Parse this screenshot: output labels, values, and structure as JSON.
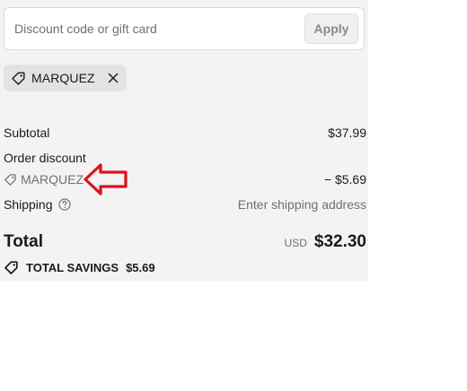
{
  "discount": {
    "placeholder": "Discount code or gift card",
    "apply_label": "Apply"
  },
  "applied_code": {
    "label": "MARQUEZ",
    "tag_icon": "tag-icon",
    "remove_icon": "close-icon"
  },
  "summary": {
    "subtotal_label": "Subtotal",
    "subtotal_value": "$37.99",
    "order_discount_label": "Order discount",
    "discount_code": "MARQUEZ",
    "discount_value": "− $5.69",
    "shipping_label": "Shipping",
    "shipping_info_icon": "help-circle-icon",
    "shipping_value": "Enter shipping address",
    "total_label": "Total",
    "currency": "USD",
    "total_value": "$32.30",
    "savings_label": "TOTAL SAVINGS",
    "savings_value": "$5.69"
  },
  "annotation": {
    "arrow_icon": "left-arrow-icon",
    "arrow_color": "#e0101a"
  }
}
